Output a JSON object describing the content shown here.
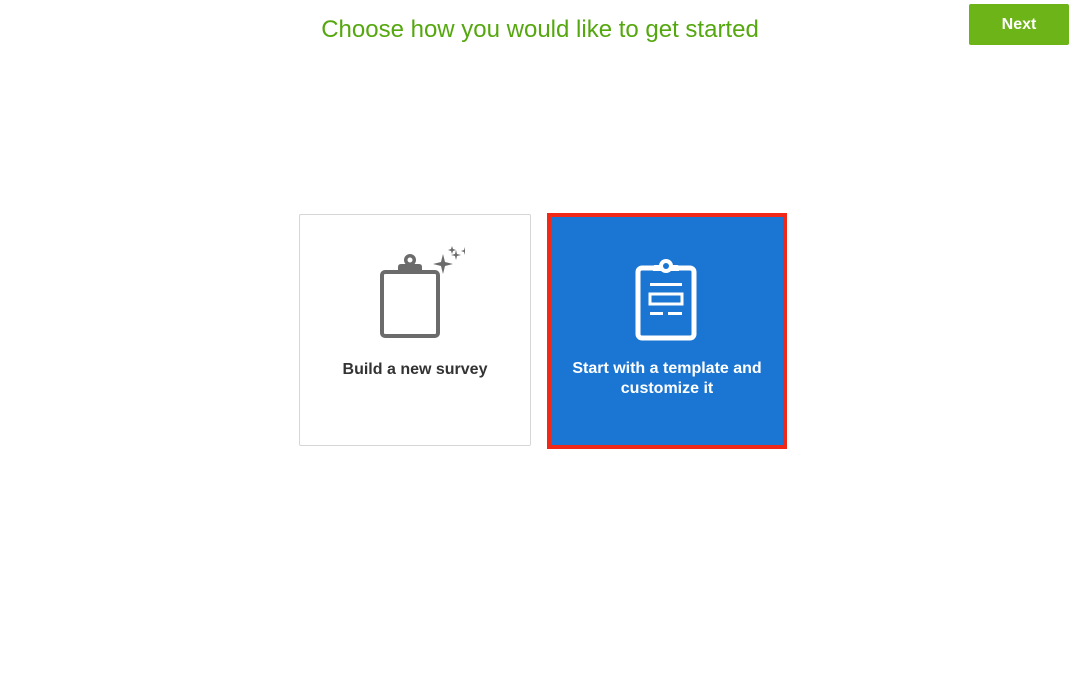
{
  "header": {
    "title": "Choose how you would like to get started",
    "next_label": "Next"
  },
  "options": [
    {
      "label": "Build a new survey",
      "icon": "clipboard-sparkle-icon"
    },
    {
      "label": "Start with a template and customize it",
      "icon": "clipboard-template-icon",
      "selected": true
    }
  ],
  "colors": {
    "title": "#55a70f",
    "next_button": "#6cb417",
    "selected_card": "#1b76d3",
    "selection_border": "#f02818"
  }
}
